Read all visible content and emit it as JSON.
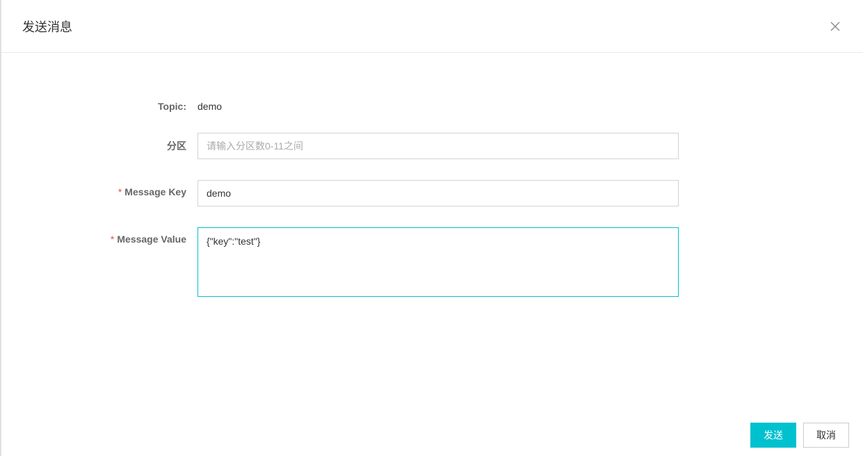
{
  "modal": {
    "title": "发送消息"
  },
  "form": {
    "topic": {
      "label": "Topic:",
      "value": "demo"
    },
    "partition": {
      "label": "分区",
      "placeholder": "请输入分区数0-11之间",
      "value": ""
    },
    "messageKey": {
      "label": "Message Key",
      "value": "demo"
    },
    "messageValue": {
      "label": "Message Value",
      "value": "{\"key\":\"test\"}"
    }
  },
  "footer": {
    "submit": "发送",
    "cancel": "取消"
  }
}
